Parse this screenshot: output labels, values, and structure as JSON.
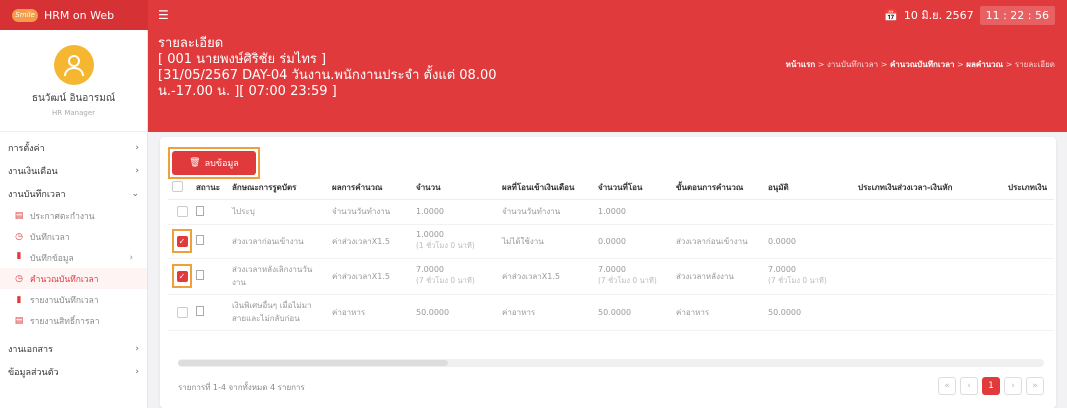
{
  "app": {
    "title": "HRM on Web",
    "logo_text": "Smile"
  },
  "clock": {
    "date": "10 มิ.ย. 2567",
    "time": "11 : 22 : 56"
  },
  "profile": {
    "name": "ธนวัฒน์ อินอารมณ์",
    "role": "HR Manager"
  },
  "sidebar": {
    "items": [
      {
        "label": "การตั้งค่า"
      },
      {
        "label": "งานเงินเดือน"
      },
      {
        "label": "งานบันทึกเวลา"
      }
    ],
    "sub_items": [
      {
        "label": "ประกาศตะกำงาน"
      },
      {
        "label": "บันทึกเวลา"
      },
      {
        "label": "บันทึกข้อมูล"
      },
      {
        "label": "คำนวณบันทึกเวลา"
      },
      {
        "label": "รายงานบันทึกเวลา"
      },
      {
        "label": "รายงานสิทธิ์การลา"
      }
    ],
    "bottom_items": [
      {
        "label": "งานเอกสาร"
      },
      {
        "label": "ข้อมูลส่วนตัว"
      }
    ]
  },
  "header": {
    "line1": "รายละเอียด",
    "line2": "[ 001 นายพงษ์ศิริชัย ร่มไทร ]",
    "line3": "[31/05/2567 DAY-04 วันงาน.พนักงานประจำ ตั้งแต่ 08.00",
    "line4": "น.-17.00 น. ][ 07:00 23:59 ]",
    "breadcrumb": [
      "หน้าแรก",
      "งานบันทึกเวลา",
      "คำนวณบันทึกเวลา",
      "ผลคำนวณ",
      "รายละเอียด"
    ]
  },
  "toolbar": {
    "delete_label": "ลบข้อมูล"
  },
  "table": {
    "headers": [
      "สถานะ",
      "ลักษณะการรูดบัตร",
      "ผลการคำนวณ",
      "จำนวน",
      "ผลที่โอนเข้าเงินเดือน",
      "จำนวนที่โอน",
      "ขั้นตอนการคำนวณ",
      "อนุมัติ",
      "ประเภทเงินส่วงเวลา-เงินหัก",
      "ประเภทเงิน"
    ],
    "rows": [
      {
        "checked": false,
        "c1": "ไประบุ",
        "c2": "จำนวนวันทำงาน",
        "c3": "1.0000",
        "c3s": "",
        "c4": "จำนวนวันทำงาน",
        "c5": "1.0000",
        "c5s": "",
        "c6": "",
        "c7": "",
        "c7s": ""
      },
      {
        "checked": true,
        "c1": "ส่วงเวลาก่อนเข้างาน",
        "c2": "ค่าส่วงเวลาX1.5",
        "c3": "1.0000",
        "c3s": "(1 ชั่วโมง 0 นาที)",
        "c4": "ไม่ได้ใช้งาน",
        "c5": "0.0000",
        "c5s": "",
        "c6": "ส่วงเวลาก่อนเข้างาน",
        "c7": "0.0000",
        "c7s": ""
      },
      {
        "checked": true,
        "c1": "ส่วงเวลาหลังเลิกงานวัน งาน",
        "c2": "ค่าส่วงเวลาX1.5",
        "c3": "7.0000",
        "c3s": "(7 ชั่วโมง 0 นาที)",
        "c4": "ค่าส่วงเวลาX1.5",
        "c5": "7.0000",
        "c5s": "(7 ชั่วโมง 0 นาที)",
        "c6": "ส่วงเวลาหลังงาน",
        "c7": "7.0000",
        "c7s": "(7 ชั่วโมง 0 นาที)"
      },
      {
        "checked": false,
        "c1": "เงินพิเศษอื่นๆ เมื่อไม่มา สายและไม่กลับก่อน",
        "c2": "ค่าอาหาร",
        "c3": "50.0000",
        "c3s": "",
        "c4": "ค่าอาหาร",
        "c5": "50.0000",
        "c5s": "",
        "c6": "ค่าอาหาร",
        "c7": "50.0000",
        "c7s": ""
      }
    ]
  },
  "footer": {
    "info": "รายการที่ 1-4 จากทั้งหมด 4 รายการ",
    "page": "1"
  },
  "colors": {
    "primary": "#e03a3c",
    "highlight": "#f0a03a",
    "avatar": "#f5b731"
  }
}
